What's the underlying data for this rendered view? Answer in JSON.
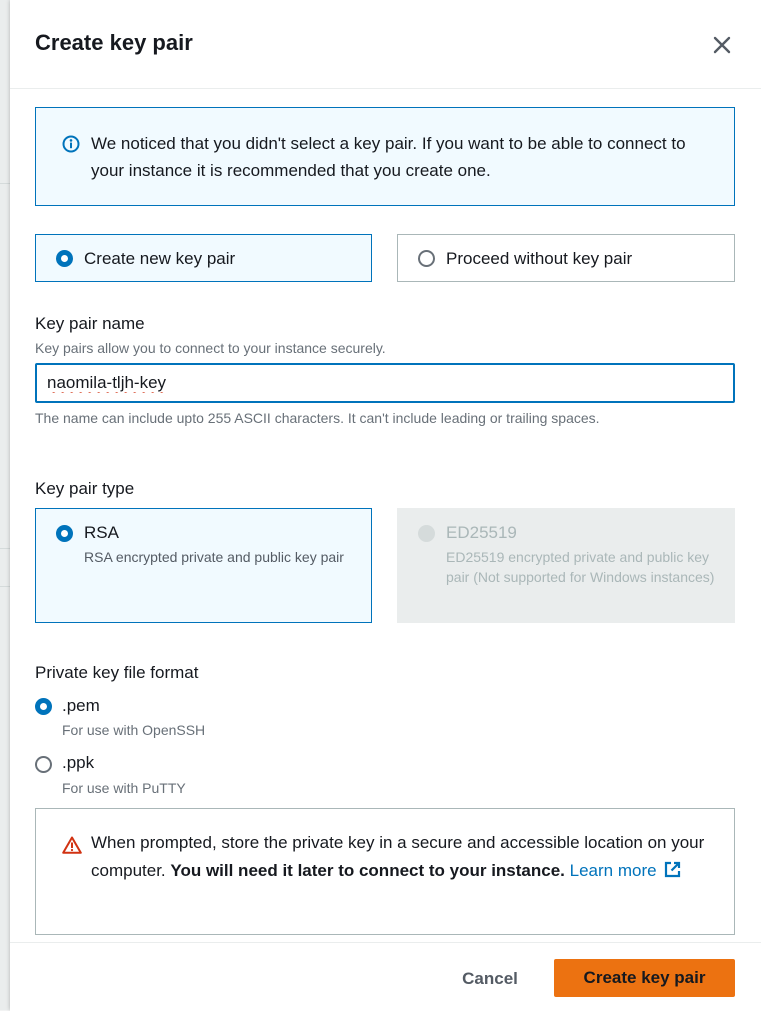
{
  "dialog": {
    "title": "Create key pair",
    "close_icon": "close-icon"
  },
  "info_alert": {
    "icon": "info-icon",
    "text": "We noticed that you didn't select a key pair. If you want to be able to connect to your instance it is recommended that you create one."
  },
  "key_pair_choice": {
    "options": [
      {
        "label": "Create new key pair",
        "selected": true
      },
      {
        "label": "Proceed without key pair",
        "selected": false
      }
    ]
  },
  "key_pair_name": {
    "label": "Key pair name",
    "description": "Key pairs allow you to connect to your instance securely.",
    "value": "naomila-tljh-key",
    "constraint": "The name can include upto 255 ASCII characters. It can't include leading or trailing spaces."
  },
  "key_pair_type": {
    "label": "Key pair type",
    "options": [
      {
        "label": "RSA",
        "description": "RSA encrypted private and public key pair",
        "selected": true,
        "disabled": false
      },
      {
        "label": "ED25519",
        "description": "ED25519 encrypted private and public key pair (Not supported for Windows instances)",
        "selected": false,
        "disabled": true
      }
    ]
  },
  "file_format": {
    "label": "Private key file format",
    "options": [
      {
        "label": ".pem",
        "description": "For use with OpenSSH",
        "selected": true
      },
      {
        "label": ".ppk",
        "description": "For use with PuTTY",
        "selected": false
      }
    ]
  },
  "warning_alert": {
    "icon": "warning-icon",
    "text_normal": "When prompted, store the private key in a secure and accessible location on your computer. ",
    "text_bold": "You will need it later to connect to your instance.",
    "link_label": "Learn more",
    "link_icon": "external-link-icon"
  },
  "footer": {
    "cancel_label": "Cancel",
    "submit_label": "Create key pair"
  },
  "colors": {
    "accent": "#0073bb",
    "primary_button": "#ec7211",
    "warning": "#d13212"
  }
}
